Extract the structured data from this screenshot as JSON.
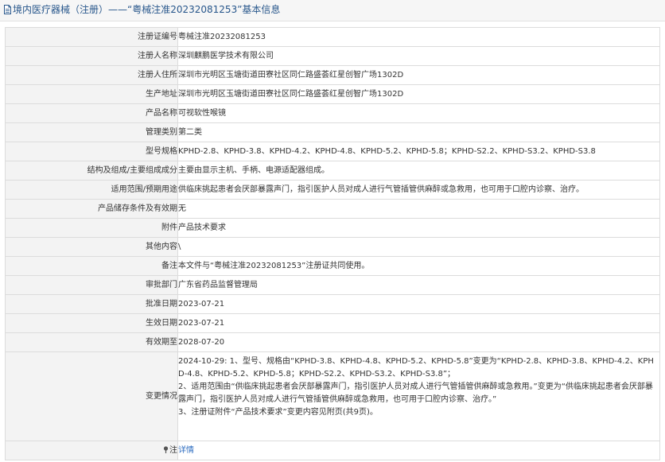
{
  "header": {
    "title": "境内医疗器械（注册）——“粤械注准20232081253”基本信息",
    "icon": "document-icon"
  },
  "rows": [
    {
      "label": "注册证编号",
      "value": "粤械注准20232081253"
    },
    {
      "label": "注册人名称",
      "value": "深圳麒鹏医学技术有限公司"
    },
    {
      "label": "注册人住所",
      "value": "深圳市光明区玉塘街道田寮社区同仁路盛荟红星创智广场1302D"
    },
    {
      "label": "生产地址",
      "value": "深圳市光明区玉塘街道田寮社区同仁路盛荟红星创智广场1302D"
    },
    {
      "label": "产品名称",
      "value": "可视软性喉镜"
    },
    {
      "label": "管理类别",
      "value": "第二类"
    },
    {
      "label": "型号规格",
      "value": "KPHD-2.8、KPHD-3.8、KPHD-4.2、KPHD-4.8、KPHD-5.2、KPHD-5.8；KPHD-S2.2、KPHD-S3.2、KPHD-S3.8"
    },
    {
      "label": "结构及组成/主要组成成分",
      "value": "主要由显示主机、手柄、电源适配器组成。"
    },
    {
      "label": "适用范围/预期用途",
      "value": "供临床挑起患者会厌部暴露声门，指引医护人员对成人进行气管插管供麻醉或急救用，也可用于口腔内诊察、治疗。"
    },
    {
      "label": "产品储存条件及有效期",
      "value": "无"
    },
    {
      "label": "附件",
      "value": "产品技术要求"
    },
    {
      "label": "其他内容",
      "value": "\\"
    },
    {
      "label": "备注",
      "value": "本文件与“粤械注准20232081253”注册证共同使用。"
    },
    {
      "label": "审批部门",
      "value": "广东省药品监督管理局"
    },
    {
      "label": "批准日期",
      "value": "2023-07-21"
    },
    {
      "label": "生效日期",
      "value": "2023-07-21"
    },
    {
      "label": "有效期至",
      "value": "2028-07-20"
    }
  ],
  "change": {
    "label": "变更情况",
    "lines": [
      "2024-10-29: 1、型号、规格由“KPHD-3.8、KPHD-4.8、KPHD-5.2、KPHD-5.8”变更为“KPHD-2.8、KPHD-3.8、KPHD-4.2、KPHD-4.8、KPHD-5.2、KPHD-5.8；KPHD-S2.2、KPHD-S3.2、KPHD-S3.8”；",
      "2、适用范围由“供临床挑起患者会厌部暴露声门，指引医护人员对成人进行气管插管供麻醉或急救用。”变更为“供临床挑起患者会厌部暴露声门，指引医护人员对成人进行气管插管供麻醉或急救用，也可用于口腔内诊察、治疗。”",
      "3、注册证附件“产品技术要求”变更内容见附页(共9页)。"
    ]
  },
  "note": {
    "label": "注",
    "icon": "pin-icon",
    "link": "详情"
  }
}
